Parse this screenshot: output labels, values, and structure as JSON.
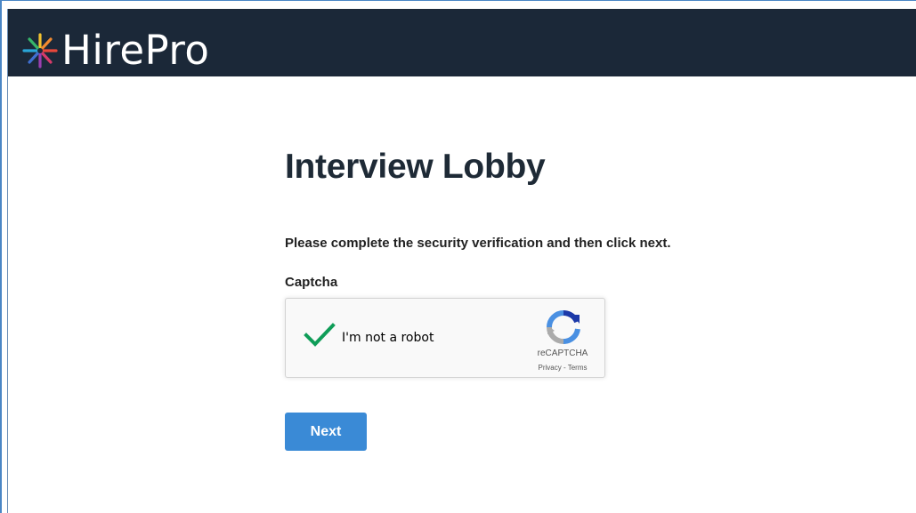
{
  "header": {
    "brand_name": "HirePro",
    "logo_icon": "starburst-logo-icon",
    "background_color": "#1b2838"
  },
  "main": {
    "title": "Interview Lobby",
    "instruction": "Please complete the security verification and then click next.",
    "captcha_label": "Captcha"
  },
  "recaptcha": {
    "checkbox_state": "checked",
    "checkbox_label": "I'm not a robot",
    "brand": "reCAPTCHA",
    "privacy_link": "Privacy",
    "separator": "-",
    "terms_link": "Terms",
    "check_color": "#0f9d58"
  },
  "actions": {
    "next_label": "Next",
    "next_color": "#3a8ad6"
  }
}
